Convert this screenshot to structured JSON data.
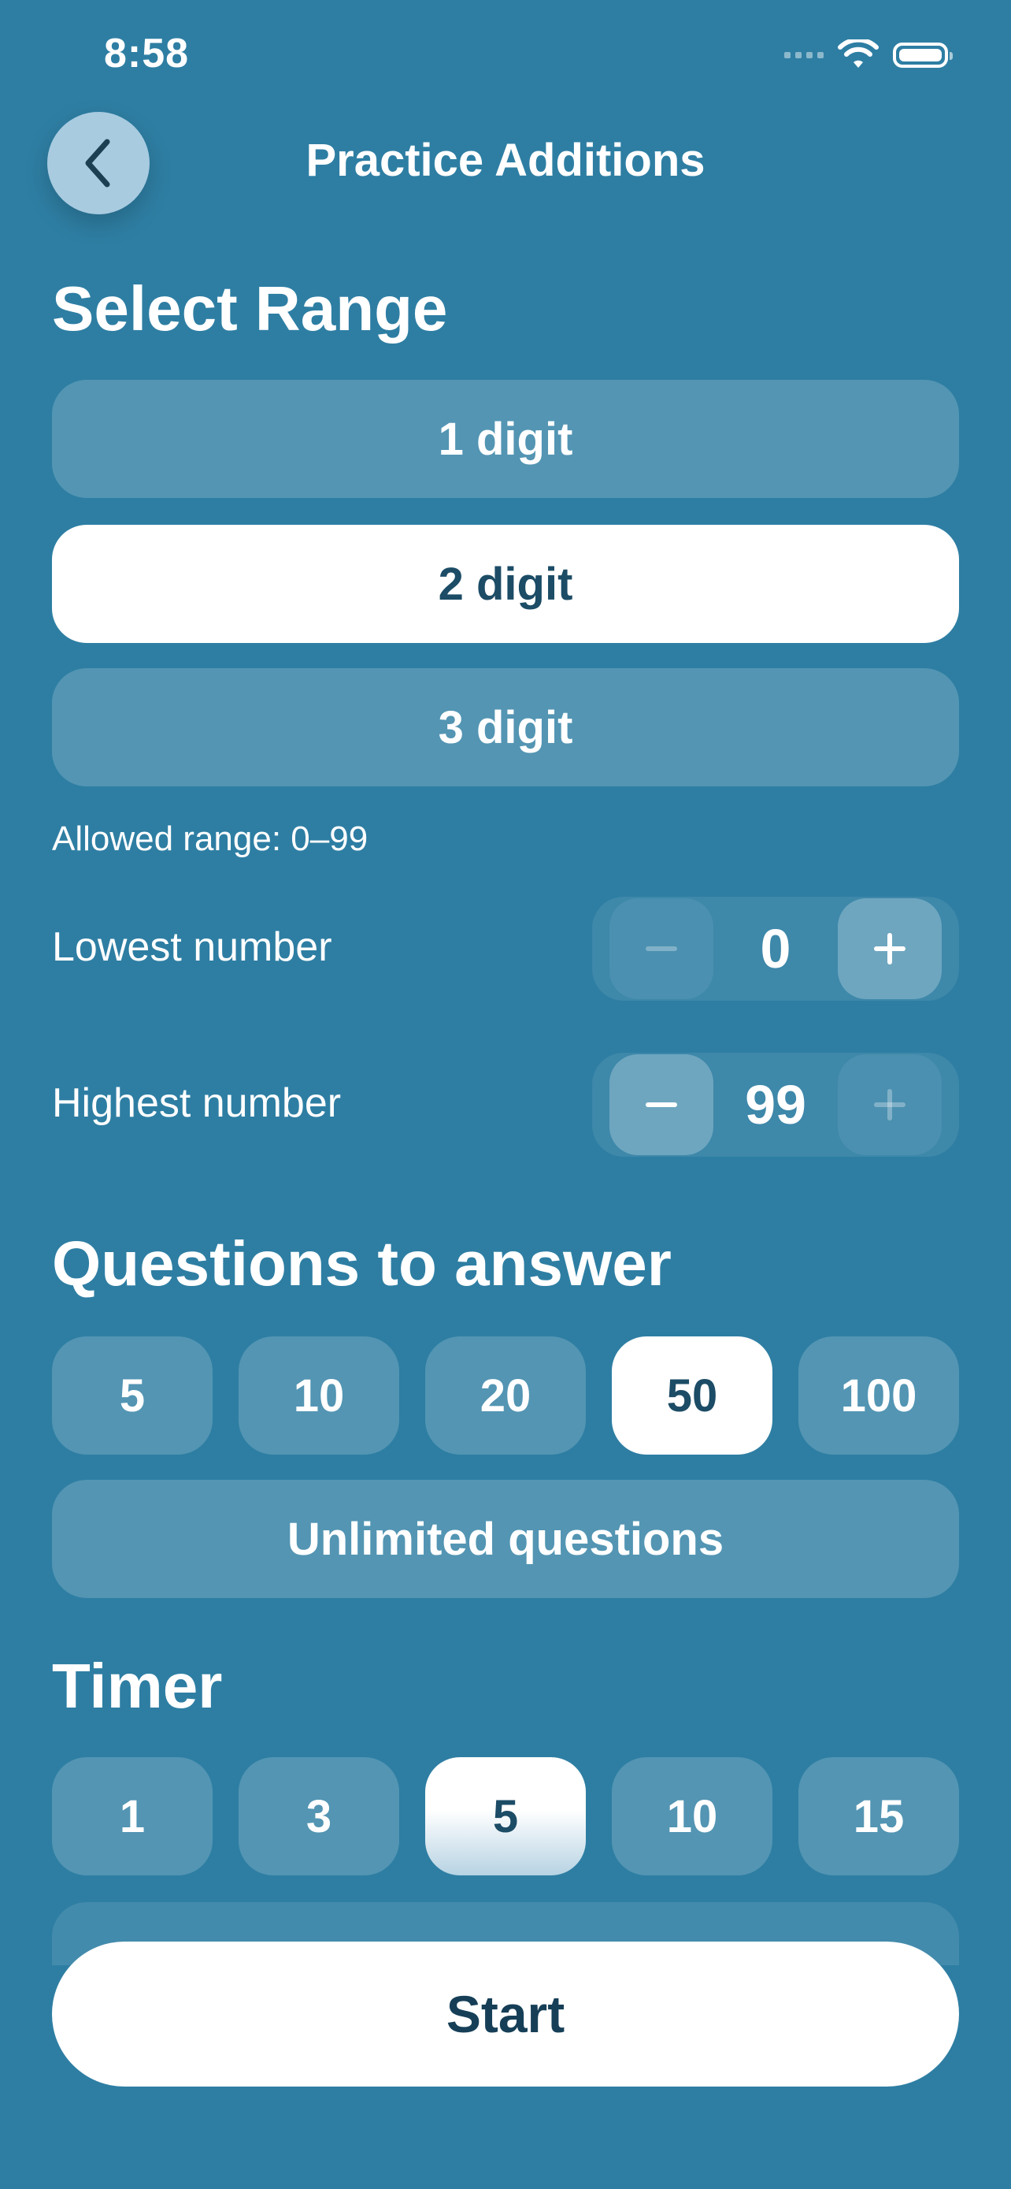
{
  "status_bar": {
    "time": "8:58"
  },
  "header": {
    "title": "Practice Additions",
    "back_icon": "chevron-left-icon"
  },
  "range": {
    "title": "Select Range",
    "options": [
      "1 digit",
      "2 digit",
      "3 digit"
    ],
    "selected": "2 digit",
    "allowed_note": "Allowed range: 0–99"
  },
  "lowest": {
    "label": "Lowest number",
    "value": "0",
    "minus": "−",
    "plus": "+"
  },
  "highest": {
    "label": "Highest number",
    "value": "99",
    "minus": "−",
    "plus": "+"
  },
  "questions": {
    "title": "Questions to answer",
    "options": [
      "5",
      "10",
      "20",
      "50",
      "100"
    ],
    "selected": "50",
    "unlimited": "Unlimited questions"
  },
  "timer": {
    "title": "Timer",
    "options": [
      "1",
      "3",
      "5",
      "10",
      "15"
    ],
    "selected": "5"
  },
  "start": {
    "label": "Start"
  },
  "colors": {
    "background": "#2e7ea3",
    "selected_text": "#1c4c66",
    "option_fill": "rgba(255,255,255,0.18)"
  }
}
